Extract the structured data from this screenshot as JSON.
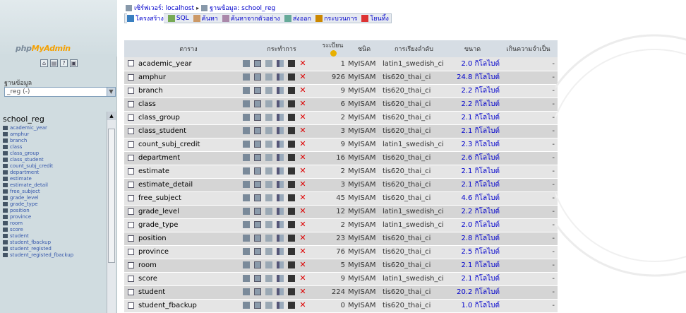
{
  "logo": {
    "part1": "php",
    "part2": "MyAdmin"
  },
  "left": {
    "db_label": "ฐานข้อมูล",
    "db_selected": "_reg (-)",
    "db_title": "school_reg",
    "tables": [
      "academic_year",
      "amphur",
      "branch",
      "class",
      "class_group",
      "class_student",
      "count_subj_credit",
      "department",
      "estimate",
      "estimate_detail",
      "free_subject",
      "grade_level",
      "grade_type",
      "position",
      "province",
      "room",
      "score",
      "student",
      "student_fbackup",
      "student_registed",
      "student_registed_fbackup"
    ]
  },
  "breadcrumb": {
    "server": "เซิร์ฟเวอร์: localhost",
    "database": "ฐานข้อมูล: school_reg"
  },
  "tabs": [
    {
      "label": "โครงสร้าง",
      "icon": "structure-icon"
    },
    {
      "label": "SQL",
      "icon": "sql-icon"
    },
    {
      "label": "ค้นหา",
      "icon": "search-icon"
    },
    {
      "label": "ค้นหาจากตัวอย่าง",
      "icon": "query-icon"
    },
    {
      "label": "ส่งออก",
      "icon": "export-icon"
    },
    {
      "label": "กระบวนการ",
      "icon": "operations-icon"
    },
    {
      "label": "โยนทิ้ง",
      "icon": "drop-icon"
    }
  ],
  "table": {
    "headers": {
      "table": "ตาราง",
      "action": "กระทำการ",
      "records": "ระเบียน",
      "type": "ชนิด",
      "collation": "การเรียงลำดับ",
      "size": "ขนาด",
      "overhead": "เกินความจำเป็น"
    },
    "rows": [
      {
        "name": "academic_year",
        "records": "1",
        "type": "MyISAM",
        "collation": "latin1_swedish_ci",
        "size": "2.0 กิโลไบต์",
        "overhead": "-"
      },
      {
        "name": "amphur",
        "records": "926",
        "type": "MyISAM",
        "collation": "tis620_thai_ci",
        "size": "24.8 กิโลไบต์",
        "overhead": "-"
      },
      {
        "name": "branch",
        "records": "9",
        "type": "MyISAM",
        "collation": "tis620_thai_ci",
        "size": "2.2 กิโลไบต์",
        "overhead": "-"
      },
      {
        "name": "class",
        "records": "6",
        "type": "MyISAM",
        "collation": "tis620_thai_ci",
        "size": "2.2 กิโลไบต์",
        "overhead": "-"
      },
      {
        "name": "class_group",
        "records": "2",
        "type": "MyISAM",
        "collation": "tis620_thai_ci",
        "size": "2.1 กิโลไบต์",
        "overhead": "-"
      },
      {
        "name": "class_student",
        "records": "3",
        "type": "MyISAM",
        "collation": "tis620_thai_ci",
        "size": "2.1 กิโลไบต์",
        "overhead": "-"
      },
      {
        "name": "count_subj_credit",
        "records": "9",
        "type": "MyISAM",
        "collation": "latin1_swedish_ci",
        "size": "2.3 กิโลไบต์",
        "overhead": "-"
      },
      {
        "name": "department",
        "records": "16",
        "type": "MyISAM",
        "collation": "tis620_thai_ci",
        "size": "2.6 กิโลไบต์",
        "overhead": "-"
      },
      {
        "name": "estimate",
        "records": "2",
        "type": "MyISAM",
        "collation": "tis620_thai_ci",
        "size": "2.1 กิโลไบต์",
        "overhead": "-"
      },
      {
        "name": "estimate_detail",
        "records": "3",
        "type": "MyISAM",
        "collation": "tis620_thai_ci",
        "size": "2.1 กิโลไบต์",
        "overhead": "-"
      },
      {
        "name": "free_subject",
        "records": "45",
        "type": "MyISAM",
        "collation": "tis620_thai_ci",
        "size": "4.6 กิโลไบต์",
        "overhead": "-"
      },
      {
        "name": "grade_level",
        "records": "12",
        "type": "MyISAM",
        "collation": "latin1_swedish_ci",
        "size": "2.2 กิโลไบต์",
        "overhead": "-"
      },
      {
        "name": "grade_type",
        "records": "2",
        "type": "MyISAM",
        "collation": "latin1_swedish_ci",
        "size": "2.0 กิโลไบต์",
        "overhead": "-"
      },
      {
        "name": "position",
        "records": "23",
        "type": "MyISAM",
        "collation": "tis620_thai_ci",
        "size": "2.8 กิโลไบต์",
        "overhead": "-"
      },
      {
        "name": "province",
        "records": "76",
        "type": "MyISAM",
        "collation": "tis620_thai_ci",
        "size": "2.5 กิโลไบต์",
        "overhead": "-"
      },
      {
        "name": "room",
        "records": "5",
        "type": "MyISAM",
        "collation": "tis620_thai_ci",
        "size": "2.1 กิโลไบต์",
        "overhead": "-"
      },
      {
        "name": "score",
        "records": "9",
        "type": "MyISAM",
        "collation": "latin1_swedish_ci",
        "size": "2.1 กิโลไบต์",
        "overhead": "-"
      },
      {
        "name": "student",
        "records": "224",
        "type": "MyISAM",
        "collation": "tis620_thai_ci",
        "size": "20.2 กิโลไบต์",
        "overhead": "-"
      },
      {
        "name": "student_fbackup",
        "records": "0",
        "type": "MyISAM",
        "collation": "tis620_thai_ci",
        "size": "1.0 กิโลไบต์",
        "overhead": "-"
      }
    ]
  }
}
